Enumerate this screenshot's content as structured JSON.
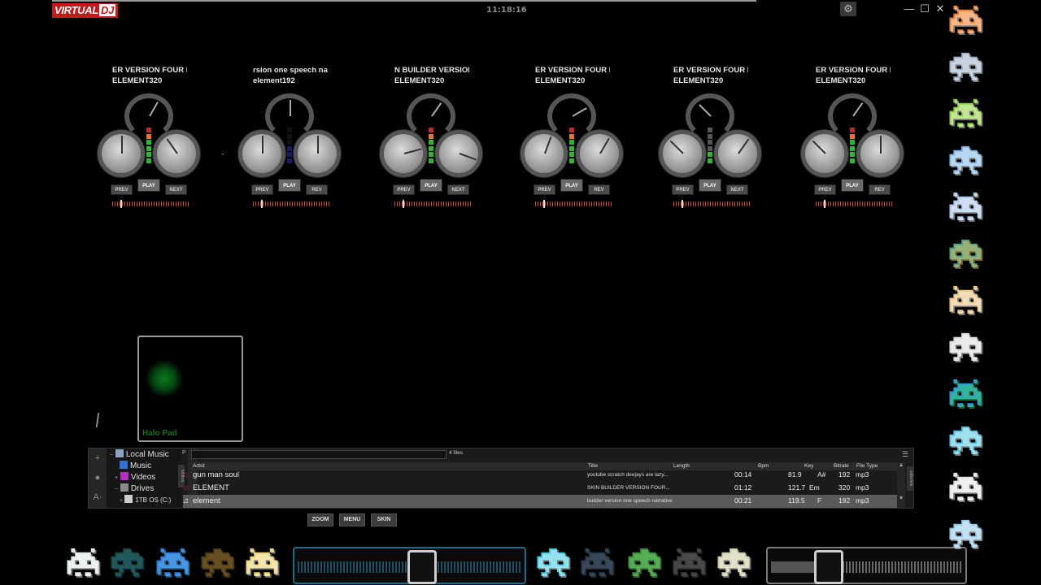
{
  "app": {
    "logo_left": "VIRTUAL",
    "logo_right": "DJ",
    "clock": "11:18:16"
  },
  "window": {
    "minimize": "—",
    "maximize": "☐",
    "close": "✕",
    "settings": "⚙"
  },
  "decks": [
    {
      "line1": "ER VERSION FOUR I",
      "line2": "ELEMENT320",
      "prev": "PREV",
      "play": "PLAY",
      "next": "NEXT"
    },
    {
      "line1": "rsion one speech  na",
      "line2": "element192",
      "prev": "PREV",
      "play": "PLAY",
      "next": "REV"
    },
    {
      "line1": "N BUILDER VERSION",
      "line2": "ELEMENT320",
      "prev": "PREV",
      "play": "PLAY",
      "next": "NEXT"
    },
    {
      "line1": "ER VERSION FOUR I",
      "line2": "ELEMENT320",
      "prev": "PREV",
      "play": "PLAY",
      "next": "REV"
    },
    {
      "line1": "ER VERSION FOUR I",
      "line2": "ELEMENT320",
      "prev": "PREV",
      "play": "PLAY",
      "next": "NEXT"
    },
    {
      "line1": "ER VERSION FOUR I",
      "line2": "ELEMENT320",
      "prev": "PREV",
      "play": "PLAY",
      "next": "REV"
    }
  ],
  "halo_pad": {
    "label": "Halo Pad"
  },
  "browser": {
    "tree": {
      "local_music": "Local Music",
      "music": "Music",
      "videos": "Videos",
      "drives": "Drives",
      "drive_c": "1TB OS (C:)"
    },
    "sidebar_tab": "folders",
    "search_placeholder": "",
    "file_count": "4 files",
    "columns": {
      "artist": "Artist",
      "title": "Title",
      "length": "Length",
      "bpm": "Bpm",
      "key": "Key",
      "bitrate": "Bitrate",
      "filetype": "File Type"
    },
    "rows": [
      {
        "artist": "gun man soul",
        "title": "youtube scratch deejays are lazy...",
        "length": "00:14",
        "bpm": "81.9",
        "key": "A#",
        "bitrate": "192",
        "filetype": "mp3"
      },
      {
        "artist": "ELEMENT",
        "title": "SKIN BUILDER VERSION FOUR...",
        "length": "01:12",
        "bpm": "121.7",
        "key": "Em",
        "bitrate": "320",
        "filetype": "mp3"
      },
      {
        "artist": "element",
        "title": "builder version one speech  narrative",
        "length": "00:21",
        "bpm": "119.5",
        "key": "F",
        "bitrate": "192",
        "filetype": "mp3"
      }
    ],
    "right_tab": "sideview"
  },
  "buttons": {
    "zoom": "ZOOM",
    "menu": "MENU",
    "skin": "SKIN"
  },
  "colors": {
    "logo_red": "#c8191a",
    "slider_border": "#1a6f86",
    "halo_green": "#0d6f1b"
  }
}
